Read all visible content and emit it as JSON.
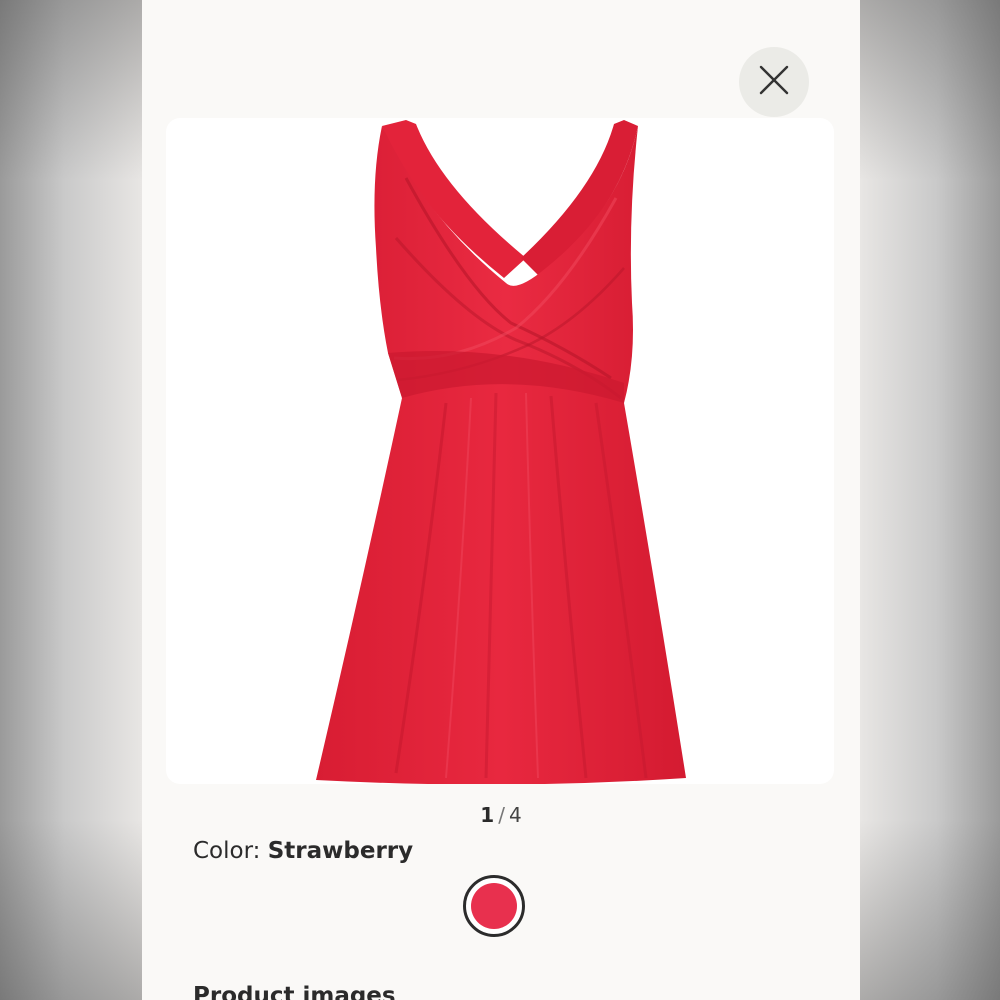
{
  "close": {
    "icon": "close-icon"
  },
  "gallery": {
    "current": "1",
    "separator": "/",
    "total": "4",
    "image_icon": "red-swim-dress-image"
  },
  "color": {
    "label": "Color:",
    "value": "Strawberry",
    "swatch_color": "#e8304e",
    "swatch_icon": "color-swatch"
  },
  "section": {
    "heading": "Product images"
  },
  "colors": {
    "background": "#faf9f7",
    "close_button_bg": "#ebebe7",
    "product_red": "#e3233a"
  }
}
